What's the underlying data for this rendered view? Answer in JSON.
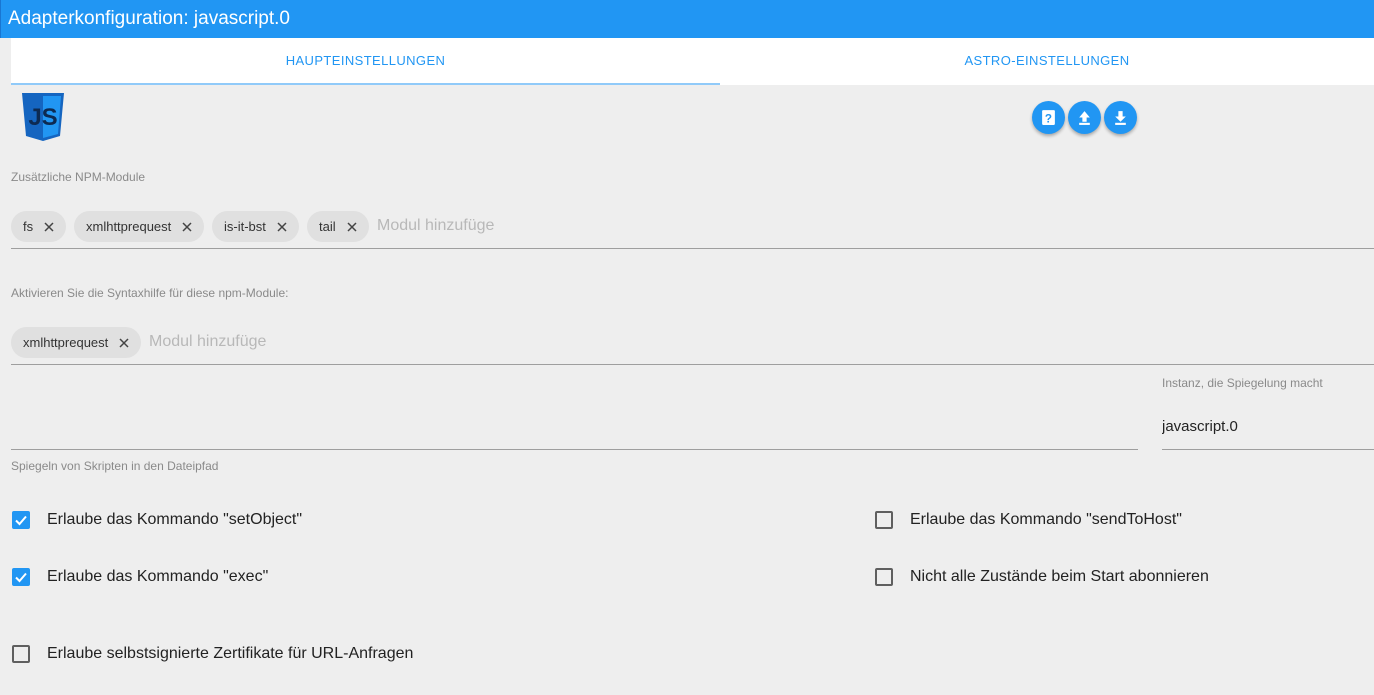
{
  "window": {
    "title": "Adapterkonfiguration: javascript.0"
  },
  "tabs": [
    {
      "label": "HAUPTEINSTELLUNGEN",
      "active": true
    },
    {
      "label": "ASTRO-EINSTELLUNGEN",
      "active": false
    }
  ],
  "accent_color": "#2196f3",
  "header_buttons": [
    {
      "icon": "help-icon"
    },
    {
      "icon": "upload-icon"
    },
    {
      "icon": "download-icon"
    }
  ],
  "npm_modules": {
    "label": "Zusätzliche NPM-Module",
    "chips": [
      "fs",
      "xmlhttprequest",
      "is-it-bst",
      "tail"
    ],
    "placeholder": "Modul hinzufüge"
  },
  "syntax_modules": {
    "label": "Aktivieren Sie die Syntaxhilfe für diese npm-Module:",
    "chips": [
      "xmlhttprequest"
    ],
    "placeholder": "Modul hinzufüge"
  },
  "mirror": {
    "path_label": "Spiegeln von Skripten in den Dateipfad",
    "path_value": "",
    "instance_label": "Instanz, die Spiegelung macht",
    "instance_value": "javascript.0"
  },
  "checkboxes": [
    {
      "label": "Erlaube das Kommando \"setObject\"",
      "checked": true
    },
    {
      "label": "Erlaube das Kommando \"exec\"",
      "checked": true
    },
    {
      "label": "Erlaube selbstsignierte Zertifikate für URL-Anfragen",
      "checked": false
    },
    {
      "label": "Erlaube das Kommando \"sendToHost\"",
      "checked": false
    },
    {
      "label": "Nicht alle Zustände beim Start abonnieren",
      "checked": false
    }
  ]
}
